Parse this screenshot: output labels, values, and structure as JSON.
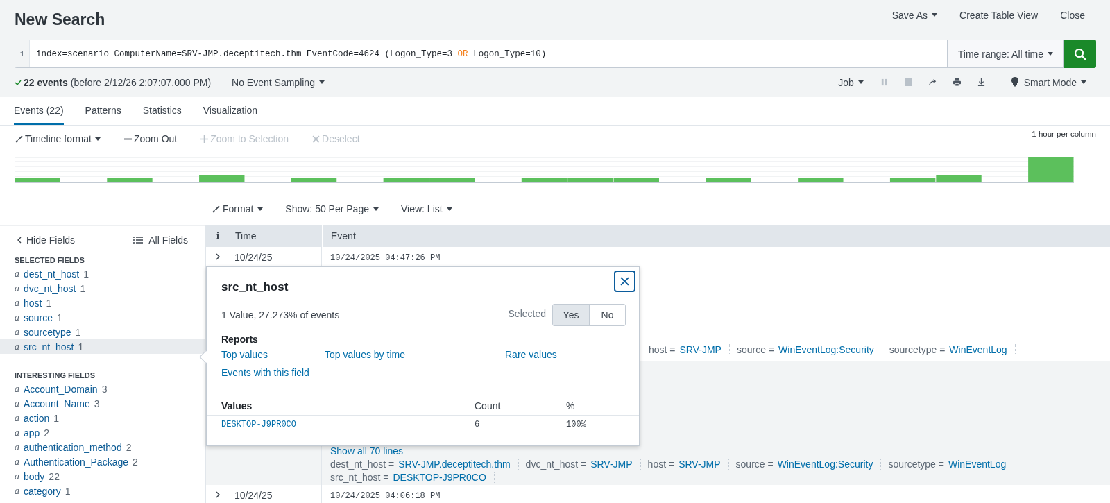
{
  "header": {
    "title": "New Search",
    "actions": [
      {
        "label": "Save As",
        "dropdown": true
      },
      {
        "label": "Create Table View",
        "dropdown": false
      },
      {
        "label": "Close",
        "dropdown": false
      }
    ]
  },
  "search": {
    "line_number": "1",
    "query": [
      {
        "kind": "plain",
        "text": "index=scenario ComputerName=SRV-JMP.deceptitech.thm EventCode=4624 (Logon_Type=3 "
      },
      {
        "kind": "keyword",
        "text": "OR"
      },
      {
        "kind": "plain",
        "text": " Logon_Type=10)"
      }
    ],
    "time_range": "Time range: All time"
  },
  "status": {
    "summary": "**22 events** (before 2/12/26 2:07:07.000 PM)",
    "sampling": "No Event Sampling"
  },
  "job_controls": [
    {
      "kind": "menu",
      "label": "Job",
      "disabled": false
    },
    {
      "kind": "pause",
      "disabled": true
    },
    {
      "kind": "stop",
      "disabled": true
    },
    {
      "kind": "share",
      "disabled": false
    },
    {
      "kind": "print",
      "disabled": false
    },
    {
      "kind": "export",
      "disabled": false
    },
    {
      "kind": "mode",
      "label": "Smart Mode",
      "disabled": false
    }
  ],
  "tabs": [
    {
      "label": "Events (22)",
      "selected": true
    },
    {
      "label": "Patterns",
      "selected": false
    },
    {
      "label": "Statistics",
      "selected": false
    },
    {
      "label": "Visualization",
      "selected": false
    }
  ],
  "timeline_toolbar": [
    {
      "kind": "format",
      "label": "Timeline format",
      "disabled": false
    },
    {
      "kind": "zoom_out",
      "label": "Zoom Out",
      "disabled": false
    },
    {
      "kind": "zoom_in",
      "label": "Zoom to Selection",
      "disabled": true
    },
    {
      "kind": "deselect",
      "label": "Deselect",
      "disabled": true
    }
  ],
  "timeline_scale": "1 hour per column",
  "results_toolbar": [
    {
      "kind": "format",
      "label": "Format"
    },
    {
      "kind": "menu",
      "label": "Show: 50 Per Page"
    },
    {
      "kind": "menu",
      "label": "View: List"
    }
  ],
  "sidebar": {
    "hide_label": "Hide Fields",
    "all_label": "All Fields",
    "sections": [
      {
        "title": "SELECTED FIELDS",
        "fields": [
          {
            "type": "a",
            "name": "dest_nt_host",
            "count": "1",
            "selected": false
          },
          {
            "type": "a",
            "name": "dvc_nt_host",
            "count": "1",
            "selected": false
          },
          {
            "type": "a",
            "name": "host",
            "count": "1",
            "selected": false
          },
          {
            "type": "a",
            "name": "source",
            "count": "1",
            "selected": false
          },
          {
            "type": "a",
            "name": "sourcetype",
            "count": "1",
            "selected": false
          },
          {
            "type": "a",
            "name": "src_nt_host",
            "count": "1",
            "selected": true
          }
        ]
      },
      {
        "title": "INTERESTING FIELDS",
        "fields": [
          {
            "type": "a",
            "name": "Account_Domain",
            "count": "3",
            "selected": false
          },
          {
            "type": "a",
            "name": "Account_Name",
            "count": "3",
            "selected": false
          },
          {
            "type": "a",
            "name": "action",
            "count": "1",
            "selected": false
          },
          {
            "type": "a",
            "name": "app",
            "count": "2",
            "selected": false
          },
          {
            "type": "a",
            "name": "authentication_method",
            "count": "2",
            "selected": false
          },
          {
            "type": "a",
            "name": "Authentication_Package",
            "count": "2",
            "selected": false
          },
          {
            "type": "a",
            "name": "body",
            "count": "22",
            "selected": false
          },
          {
            "type": "a",
            "name": "category",
            "count": "1",
            "selected": false
          }
        ]
      }
    ]
  },
  "table": {
    "columns": [
      "i",
      "Time",
      "Event"
    ]
  },
  "events": [
    {
      "time": "10/24/25",
      "raw": "10/24/2025 04:47:26 PM",
      "fields": [
        {
          "key": "host =",
          "value": "SRV-JMP"
        },
        {
          "key": "source =",
          "value": "WinEventLog:Security"
        },
        {
          "key": "sourcetype =",
          "value": "WinEventLog"
        }
      ]
    },
    {
      "show_all": "Show all 70 lines",
      "fields": [
        {
          "key": "dest_nt_host =",
          "value": "SRV-JMP.deceptitech.thm"
        },
        {
          "key": "dvc_nt_host =",
          "value": "SRV-JMP"
        },
        {
          "key": "host =",
          "value": "SRV-JMP"
        },
        {
          "key": "source =",
          "value": "WinEventLog:Security"
        },
        {
          "key": "sourcetype =",
          "value": "WinEventLog"
        },
        {
          "key": "src_nt_host =",
          "value": "DESKTOP-J9PR0CO"
        }
      ]
    },
    {
      "time": "10/24/25",
      "raw": "10/24/2025 04:06:18 PM"
    }
  ],
  "popup": {
    "title": "src_nt_host",
    "summary": "1 Value, 27.273% of events",
    "selected_label": "Selected",
    "options": [
      {
        "label": "Yes",
        "selected": true
      },
      {
        "label": "No",
        "selected": false
      }
    ],
    "reports_title": "Reports",
    "reports": [
      "Top values",
      "Top values by time",
      "Rare values",
      "Events with this field"
    ],
    "columns": [
      "Values",
      "Count",
      "%"
    ],
    "rows": [
      {
        "value": "DESKTOP-J9PR0CO",
        "count": "6",
        "percent": "100%"
      }
    ]
  }
}
